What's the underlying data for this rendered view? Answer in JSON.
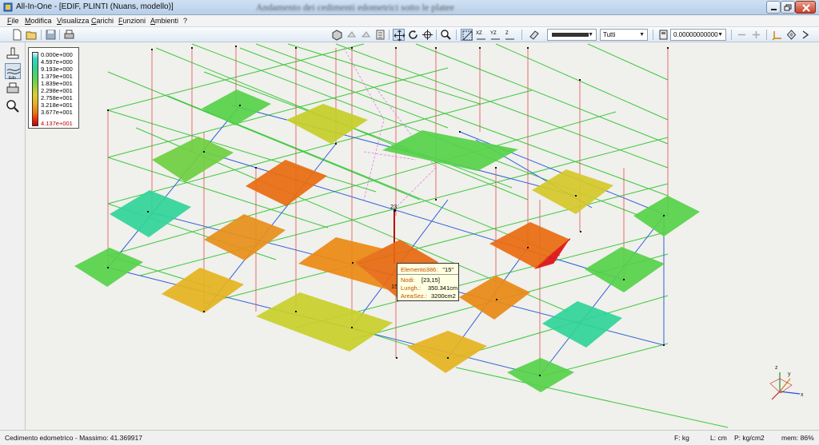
{
  "window": {
    "title": "All-In-One - [EDIF, PLINTI (Nuans, modello)]",
    "view_title": "Andamento dei cedimenti edometrici sotto le platee"
  },
  "menu": [
    "File",
    "Modifica",
    "Visualizza",
    "Carichi",
    "Funzioni",
    "Ambienti",
    "?"
  ],
  "toolbar": {
    "line_combo_value": "",
    "filter_combo_value": "Tutti",
    "number_combo_value": "0.00000000000",
    "icons": [
      "new-icon",
      "open-icon",
      "save-icon",
      "print-icon",
      "view-3d-icon",
      "rotate-view-icon",
      "pan-icon",
      "pan-mode-icon",
      "rotate-icon",
      "orbit-icon",
      "zoom-icon",
      "plane-xy-icon",
      "plane-xz-icon",
      "plane-yz-icon",
      "eraser-icon",
      "properties-icon",
      "remove-icon",
      "add-icon",
      "axes-icon",
      "navigate-icon"
    ]
  },
  "left_tools": [
    "stamp-icon",
    "settlement-tool-icon",
    "print-preview-icon",
    "magnify-icon"
  ],
  "legend": {
    "values": [
      "0.000e+000",
      "4.597e+000",
      "9.193e+000",
      "1.379e+001",
      "1.839e+001",
      "2.298e+001",
      "2.758e+001",
      "3.218e+001",
      "3.677e+001",
      "4.137e+001"
    ],
    "colors": {
      "min": "#dff0f4",
      "max": "#c00000"
    }
  },
  "scene": {
    "node_label": "23",
    "element_label": "15"
  },
  "tooltip": {
    "title_key": "Elemento386:",
    "title_val": "\"15\"",
    "rows": [
      {
        "key": "Nodi:",
        "val": "[23,15]"
      },
      {
        "key": "Lungh.:",
        "val": "350.341cm"
      },
      {
        "key": "AreaSez.:",
        "val": "3200cm2"
      }
    ]
  },
  "axes": {
    "x": "x",
    "y": "y",
    "z": "z"
  },
  "status": {
    "message": "Cedimento edometrico - Massimo: 41.369917",
    "force_unit": "F: kg",
    "length_unit": "L: cm",
    "pressure_unit": "P: kg/cm2",
    "memory": "mem: 86%"
  },
  "colors": {
    "grid_green": "#3cc83c",
    "beam_blue": "#3060d8",
    "column_red": "#e04040"
  }
}
